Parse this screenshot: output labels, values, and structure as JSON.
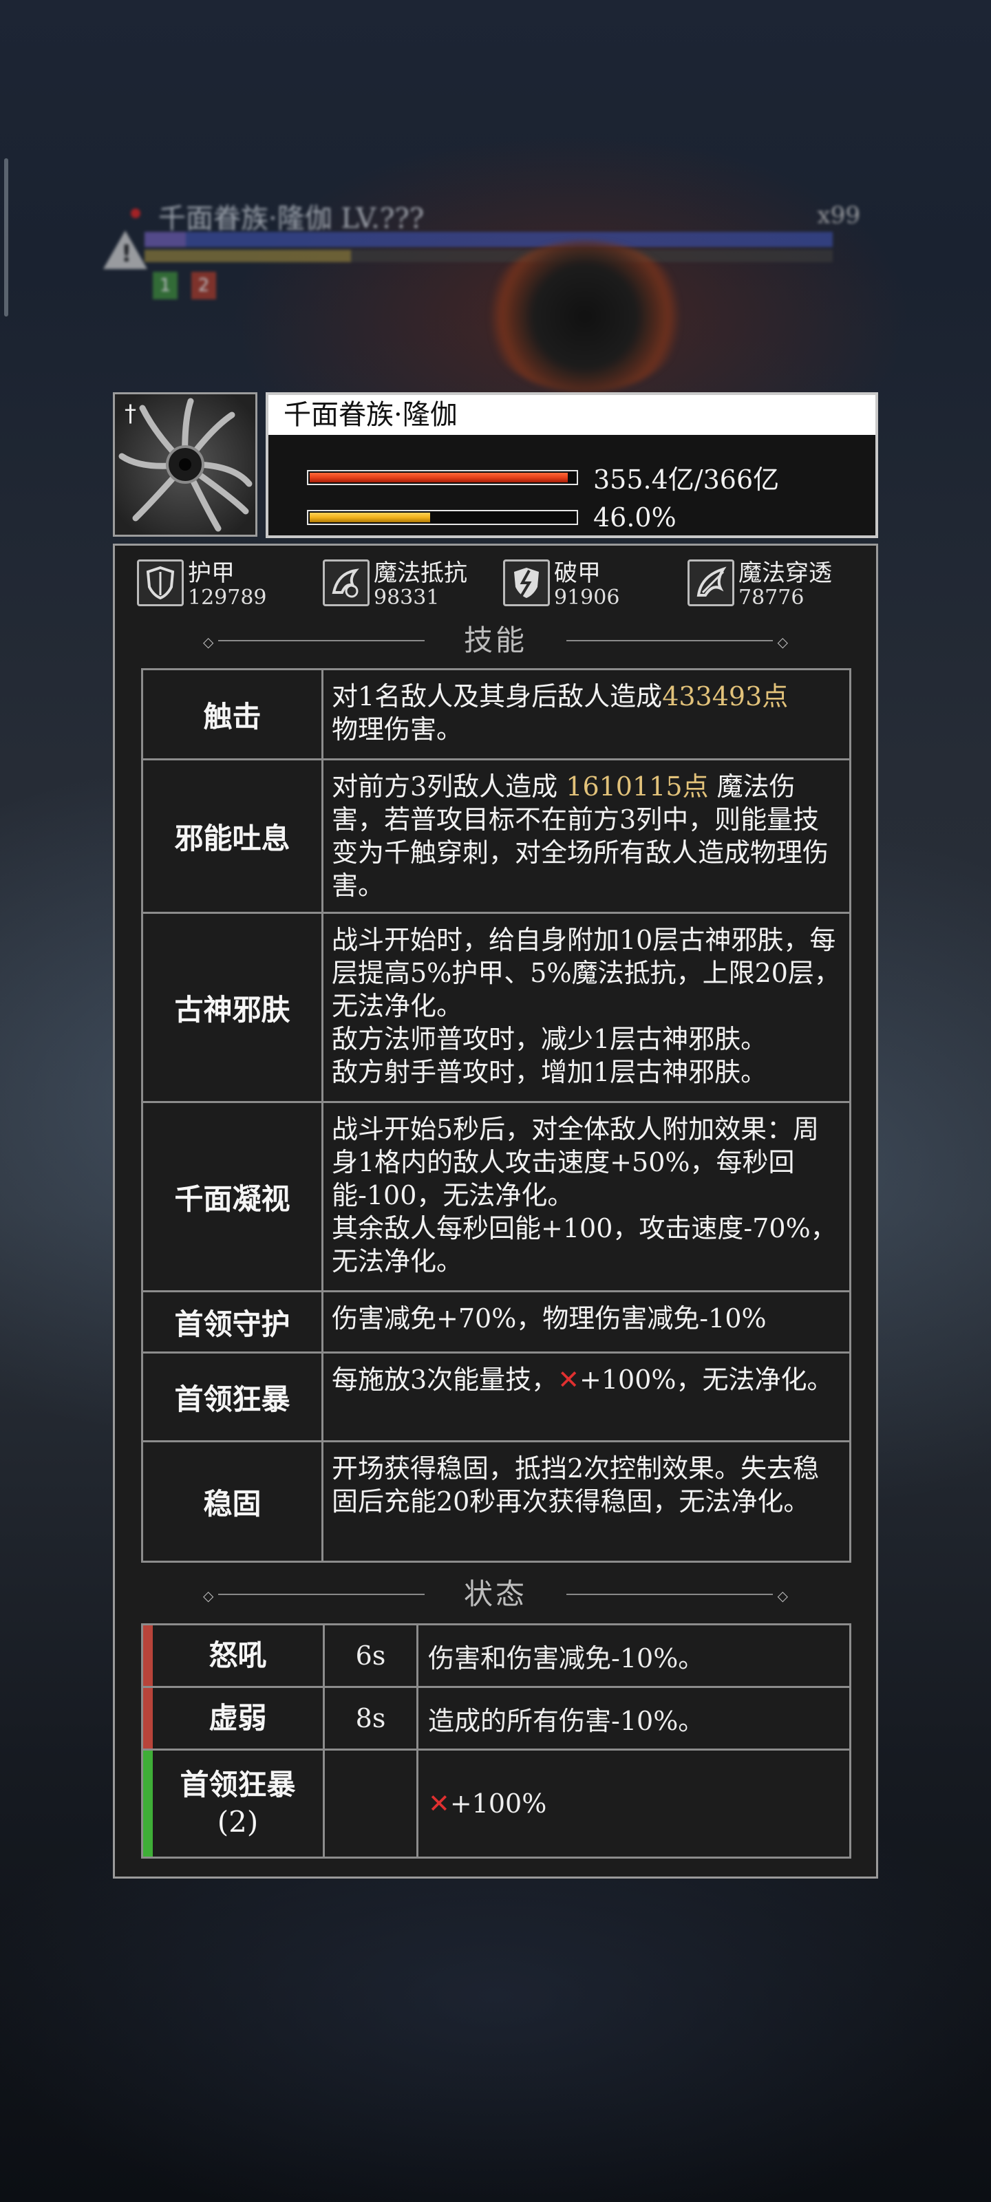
{
  "boss_hud": {
    "name": "千面眷族·隆伽 LV.???",
    "count": "x99",
    "badge1": "1",
    "badge2": "2",
    "warn_icon": "warning-icon"
  },
  "boss": {
    "name": "千面眷族·隆伽",
    "hp_text": "355.4亿/366亿",
    "hp_fraction": 0.971,
    "energy_text": "46.0%",
    "energy_fraction": 0.46,
    "colors": {
      "hp": "#e8421a",
      "energy": "#f2b21c"
    }
  },
  "stats": [
    {
      "icon": "armor-shield-icon",
      "label": "护甲",
      "value": "129789"
    },
    {
      "icon": "magic-resist-icon",
      "label": "魔法抵抗",
      "value": "98331"
    },
    {
      "icon": "armor-break-icon",
      "label": "破甲",
      "value": "91906"
    },
    {
      "icon": "magic-penetration-icon",
      "label": "魔法穿透",
      "value": "78776"
    }
  ],
  "sections": {
    "skills": "技能",
    "status": "状态"
  },
  "skills": [
    {
      "name": "触击",
      "d1": "对1名敌人及其身后敌人造成",
      "d_gold": "433493点",
      "d2": "物理伤害。"
    },
    {
      "name": "邪能吐息",
      "d1": "对前方3列敌人造成 ",
      "d_gold": "1610115点",
      "d2": " 魔法伤害，若普攻目标不在前方3列中，则能量技变为千触穿刺，对全场所有敌人造成物理伤害。"
    },
    {
      "name": "古神邪肤",
      "d1": "战斗开始时，给自身附加10层古神邪肤，每层提高5%护甲、5%魔法抵抗，上限20层，无法净化。",
      "d_line2": "敌方法师普攻时，减少1层古神邪肤。",
      "d_line3": "敌方射手普攻时，增加1层古神邪肤。"
    },
    {
      "name": "千面凝视",
      "d1": "战斗开始5秒后，对全体敌人附加效果：周身1格内的敌人攻击速度+50%，每秒回能-100，无法净化。",
      "d_line2": "其余敌人每秒回能+100，攻击速度-70%，无法净化。"
    },
    {
      "name": "首领守护",
      "d1": "伤害减免+70%，物理伤害减免-10%"
    },
    {
      "name": "首领狂暴",
      "d1": "每施放3次能量技，",
      "d_icon": "sword-cross-icon",
      "d2": "+100%，无法净化。"
    },
    {
      "name": "稳固",
      "d1": "开场获得稳固，抵挡2次控制效果。失去稳固后充能20秒再次获得稳固，无法净化。"
    }
  ],
  "status": [
    {
      "name": "怒吼",
      "duration": "6s",
      "desc": "伤害和伤害减免-10%。",
      "color": "#b8443a"
    },
    {
      "name": "虚弱",
      "duration": "8s",
      "desc": "造成的所有伤害-10%。",
      "color": "#b8443a"
    },
    {
      "name": "首领狂暴",
      "name2": "(2)",
      "duration": "",
      "desc_icon": "sword-cross-icon",
      "desc": "+100%",
      "color": "#3fae37"
    }
  ]
}
